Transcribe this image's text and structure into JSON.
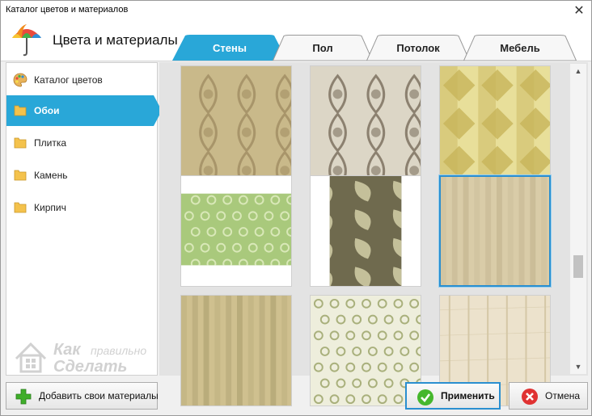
{
  "window": {
    "title": "Каталог цветов и материалов",
    "close_glyph": "✕"
  },
  "header": {
    "heading": "Цвета и материалы",
    "logo_icon": "umbrella-palette-icon"
  },
  "tabs": [
    {
      "label": "Стены",
      "active": true
    },
    {
      "label": "Пол",
      "active": false
    },
    {
      "label": "Потолок",
      "active": false
    },
    {
      "label": "Мебель",
      "active": false
    }
  ],
  "sidebar": {
    "items": [
      {
        "label": "Каталог цветов",
        "icon": "palette-icon",
        "active": false
      },
      {
        "label": "Обои",
        "icon": "folder-icon",
        "active": true
      },
      {
        "label": "Плитка",
        "icon": "folder-icon",
        "active": false
      },
      {
        "label": "Камень",
        "icon": "folder-icon",
        "active": false
      },
      {
        "label": "Кирпич",
        "icon": "folder-icon",
        "active": false
      }
    ]
  },
  "grid": {
    "selected_index": 5,
    "scroll_up_glyph": "▲",
    "scroll_down_glyph": "▼",
    "tiles": [
      {
        "name": "wallpaper-damask-gold",
        "colors": [
          "#c9b98a",
          "#a8956a"
        ]
      },
      {
        "name": "wallpaper-damask-grey",
        "colors": [
          "#dcd6c6",
          "#8c8170"
        ]
      },
      {
        "name": "wallpaper-geometric-yellow",
        "colors": [
          "#e8df9a",
          "#c7b45a"
        ]
      },
      {
        "name": "wallpaper-floral-green",
        "colors": [
          "#a9c97c",
          "#d9e8b8"
        ]
      },
      {
        "name": "wallpaper-paisley-dark",
        "colors": [
          "#6f6a4e",
          "#d4cfa8"
        ]
      },
      {
        "name": "wallpaper-stripe-beige",
        "colors": [
          "#d9cca8",
          "#bfb08a"
        ]
      },
      {
        "name": "wallpaper-stripe-olive",
        "colors": [
          "#cfc08f",
          "#a89a6b"
        ]
      },
      {
        "name": "wallpaper-floral-cream",
        "colors": [
          "#eeeedc",
          "#a9b07c"
        ]
      },
      {
        "name": "wallpaper-wood-light",
        "colors": [
          "#ece2cc",
          "#d4c7a6"
        ]
      }
    ]
  },
  "watermark": {
    "line1": "Как",
    "line1b": "правильно",
    "line2": "Сделать"
  },
  "buttons": {
    "add_label": "Добавить свои материалы",
    "apply_label": "Применить",
    "cancel_label": "Отмена"
  },
  "colors": {
    "accent": "#29a7d8",
    "selection_border": "#2a8fd0",
    "add_icon": "#3fae2a",
    "apply_icon": "#45b72d",
    "cancel_icon": "#e03232",
    "folder": "#f4c24c"
  }
}
